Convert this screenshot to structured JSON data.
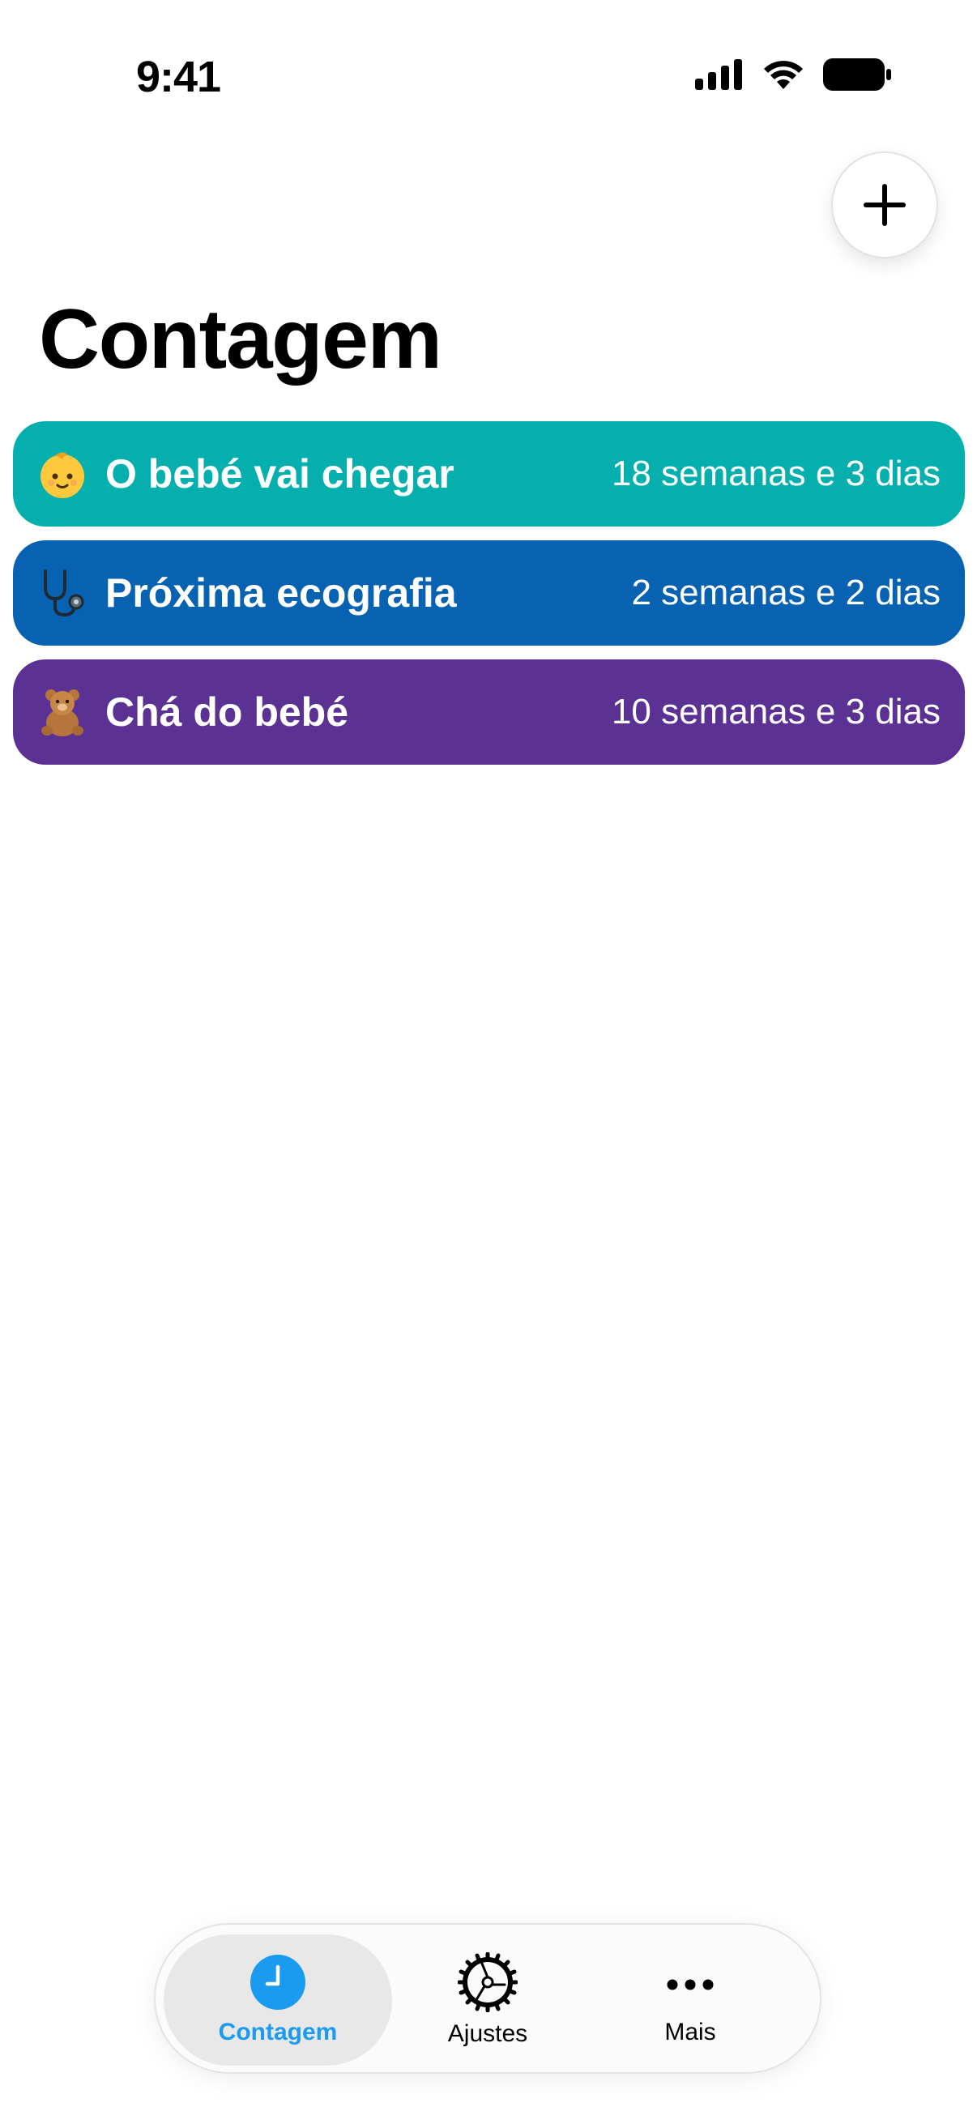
{
  "status_bar": {
    "time": "9:41"
  },
  "header": {
    "title": "Contagem",
    "add_button_icon": "plus-icon"
  },
  "events": [
    {
      "emoji": "baby-face-icon",
      "name": "O bebé vai chegar",
      "time_left": "18 semanas e 3 dias",
      "color": "#05AFAE"
    },
    {
      "emoji": "stethoscope-icon",
      "name": "Próxima ecografia",
      "time_left": "2 semanas e 2 dias",
      "color": "#0762B1"
    },
    {
      "emoji": "teddy-bear-icon",
      "name": "Chá do bebé",
      "time_left": "10 semanas e 3 dias",
      "color": "#5B3293"
    }
  ],
  "tabbar": {
    "tabs": [
      {
        "label": "Contagem",
        "icon": "clock-icon",
        "active": true
      },
      {
        "label": "Ajustes",
        "icon": "gear-icon",
        "active": false
      },
      {
        "label": "Mais",
        "icon": "ellipsis-icon",
        "active": false
      }
    ]
  },
  "colors": {
    "accent": "#1A9BF0"
  }
}
